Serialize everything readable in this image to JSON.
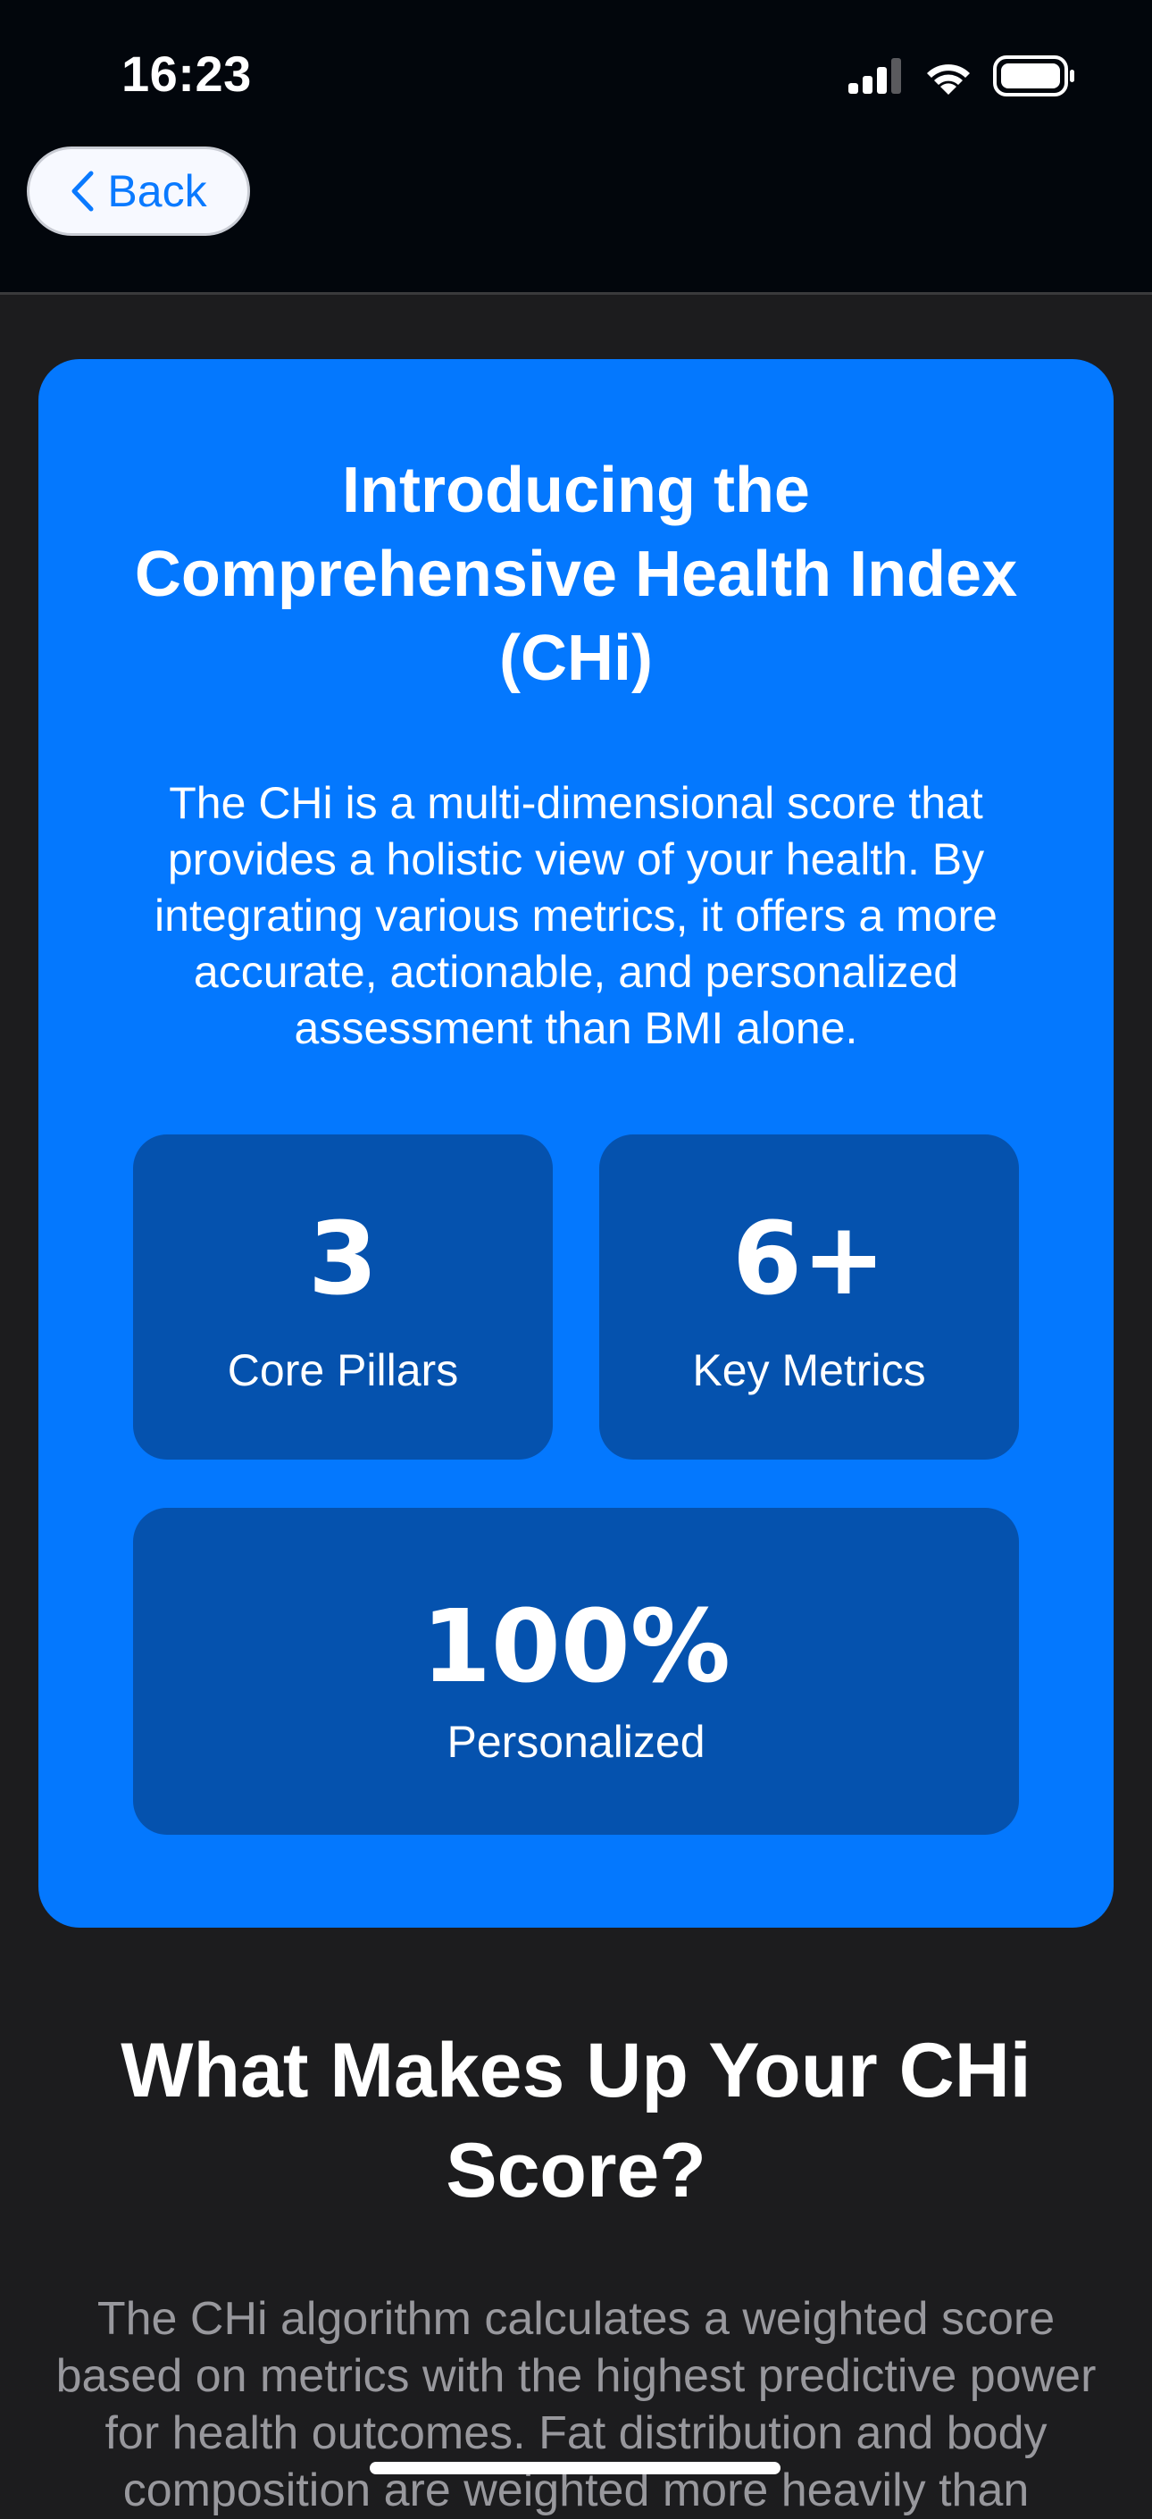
{
  "status_bar": {
    "time": "16:23",
    "icons": [
      "signal-icon",
      "wifi-icon",
      "battery-icon"
    ]
  },
  "nav": {
    "back_label": "Back",
    "back_icon": "chevron-left-icon"
  },
  "hero": {
    "title": "Introducing the Comprehensive Health Index (CHi)",
    "description": "The CHi is a multi-dimensional score that provides a holistic view of your health. By integrating various metrics, it offers a more accurate, actionable, and personalized assessment than BMI alone.",
    "stats": [
      {
        "value": "3",
        "label": "Core Pillars"
      },
      {
        "value": "6+",
        "label": "Key Metrics"
      },
      {
        "value": "100%",
        "label": "Personalized"
      }
    ]
  },
  "section": {
    "title": "What Makes Up Your CHi Score?",
    "body": "The CHi algorithm calculates a weighted score based on metrics with the highest predictive power for health outcomes. Fat distribution and body composition are weighted more heavily than"
  },
  "colors": {
    "background": "#1c1c1e",
    "topbar": "#02060c",
    "hero_card": "#0478fe",
    "stat_card": "#0552ae",
    "accent": "#0a7aff",
    "muted_text": "#98989d"
  }
}
